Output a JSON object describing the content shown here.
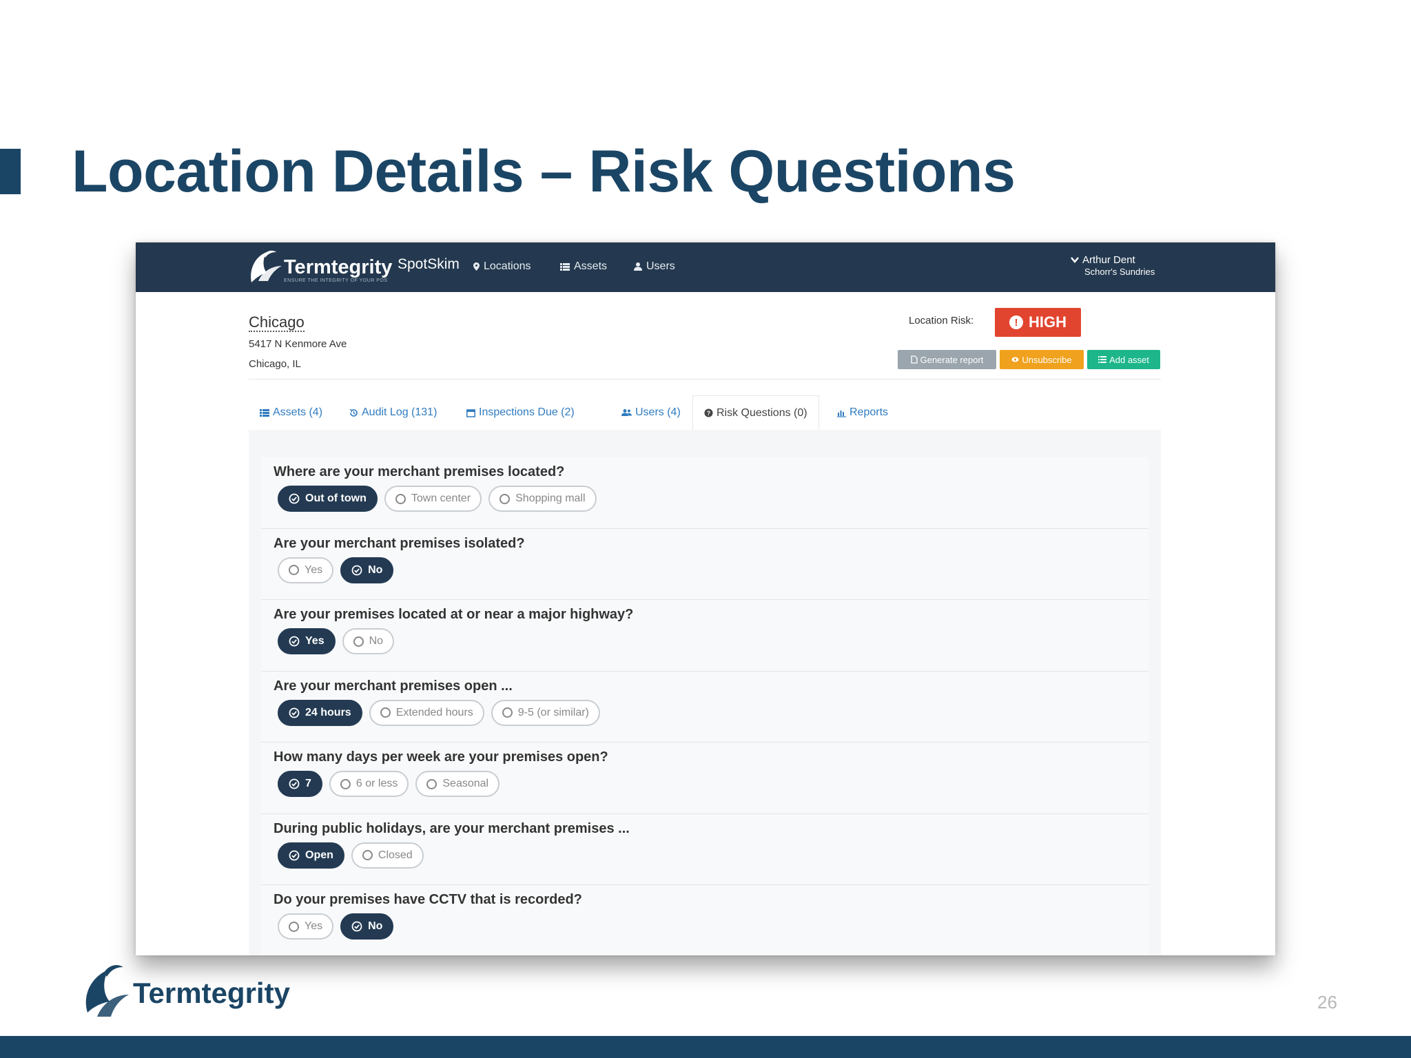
{
  "slide": {
    "title": "Location Details – Risk Questions",
    "page_number": "26",
    "footer_logo_text": "Termtegrity"
  },
  "navbar": {
    "logo_text": "Termtegrity",
    "tagline": "ENSURE THE INTEGRITY OF YOUR POS",
    "brand": "SpotSkim",
    "items": [
      {
        "label": "Locations",
        "icon": "map-pin-icon"
      },
      {
        "label": "Assets",
        "icon": "list-icon"
      },
      {
        "label": "Users",
        "icon": "user-icon"
      }
    ],
    "user": {
      "name": "Arthur Dent",
      "org": "Schorr's Sundries"
    }
  },
  "location": {
    "name": "Chicago",
    "address_line1": "5417 N Kenmore Ave",
    "address_line2": "Chicago, IL",
    "risk_label": "Location Risk:",
    "risk_value": "HIGH",
    "risk_color": "#e2452f"
  },
  "actions": {
    "generate_report": "Generate report",
    "unsubscribe": "Unsubscribe",
    "add_asset": "Add asset"
  },
  "tabs": [
    {
      "label": "Assets (4)",
      "icon": "list-icon"
    },
    {
      "label": "Audit Log (131)",
      "icon": "history-icon"
    },
    {
      "label": "Inspections Due (2)",
      "icon": "calendar-icon"
    },
    {
      "label": "Users (4)",
      "icon": "users-icon"
    },
    {
      "label": "Risk Questions (0)",
      "icon": "question-circle-icon",
      "active": true
    },
    {
      "label": "Reports",
      "icon": "bar-chart-icon"
    }
  ],
  "questions": [
    {
      "text": "Where are your merchant premises located?",
      "options": [
        "Out of town",
        "Town center",
        "Shopping mall"
      ],
      "selected": 0
    },
    {
      "text": "Are your merchant premises isolated?",
      "options": [
        "Yes",
        "No"
      ],
      "selected": 1
    },
    {
      "text": "Are your premises located at or near a major highway?",
      "options": [
        "Yes",
        "No"
      ],
      "selected": 0
    },
    {
      "text": "Are your merchant premises open ...",
      "options": [
        "24 hours",
        "Extended hours",
        "9-5 (or similar)"
      ],
      "selected": 0
    },
    {
      "text": "How many days per week are your premises open?",
      "options": [
        "7",
        "6 or less",
        "Seasonal"
      ],
      "selected": 0
    },
    {
      "text": "During public holidays, are your merchant premises ...",
      "options": [
        "Open",
        "Closed"
      ],
      "selected": 0
    },
    {
      "text": "Do your premises have CCTV that is recorded?",
      "options": [
        "Yes",
        "No"
      ],
      "selected": 1
    }
  ],
  "colors": {
    "brand_navy": "#1b4565",
    "navbar": "#24394f",
    "selected_pill": "#233a52",
    "report_btn": "#9aa5ad",
    "unsubscribe_btn": "#f0a11d",
    "add_asset_btn": "#1cb68a"
  }
}
